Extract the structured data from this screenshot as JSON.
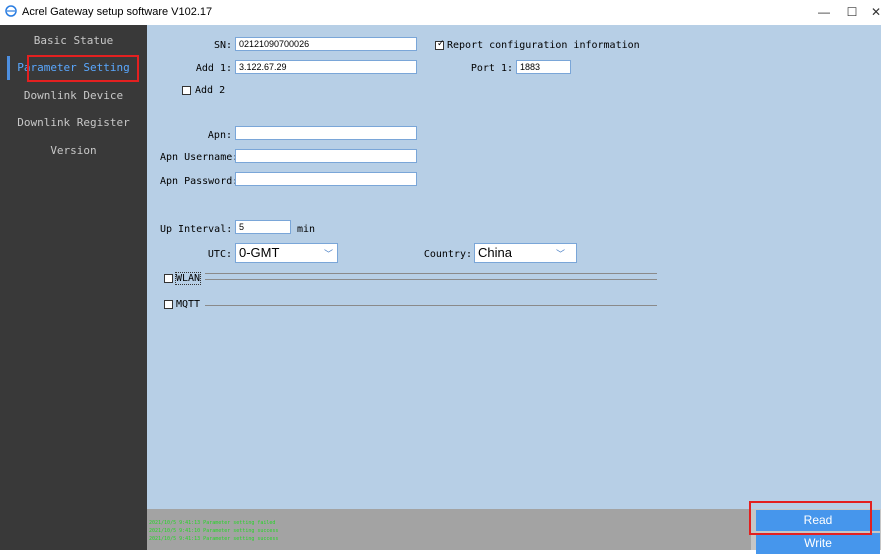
{
  "window": {
    "title": "Acrel Gateway setup software V102.17",
    "minimize": "—",
    "maximize": "☐",
    "close": "✕"
  },
  "sidebar": {
    "items": [
      {
        "label": "Basic Statue"
      },
      {
        "label": "Parameter Setting",
        "active": true
      },
      {
        "label": "Downlink Device"
      },
      {
        "label": "Downlink Register"
      },
      {
        "label": "Version"
      }
    ]
  },
  "form": {
    "sn_label": "SN:",
    "sn_value": "02121090700026",
    "report_label": "Report configuration information",
    "report_checked": true,
    "add1_label": "Add 1:",
    "add1_value": "3.122.67.29",
    "port1_label": "Port 1:",
    "port1_value": "1883",
    "add2_label": "Add 2",
    "add2_checked": false,
    "apn_label": "Apn:",
    "apn_value": "",
    "apn_user_label": "Apn Username:",
    "apn_user_value": "",
    "apn_pass_label": "Apn Password:",
    "apn_pass_value": "",
    "interval_label": "Up Interval:",
    "interval_value": "5",
    "interval_unit": "min",
    "utc_label": "UTC:",
    "utc_value": "0-GMT",
    "country_label": "Country:",
    "country_value": "China",
    "wlan_label": "WLAN",
    "wlan_checked": false,
    "mqtt_label": "MQTT",
    "mqtt_checked": false
  },
  "log": {
    "lines": [
      "2021/10/5 9:41:13  Parameter setting failed",
      "2021/10/5 9:41:10  Parameter setting success",
      "2021/10/5 9:41:13  Parameter setting success"
    ]
  },
  "buttons": {
    "read": "Read",
    "write": "Write"
  },
  "colors": {
    "sidebar_bg": "#393939",
    "main_bg": "#b7cfe6",
    "accent": "#4696ec",
    "highlight": "#e32020",
    "log_text": "#27d427"
  }
}
